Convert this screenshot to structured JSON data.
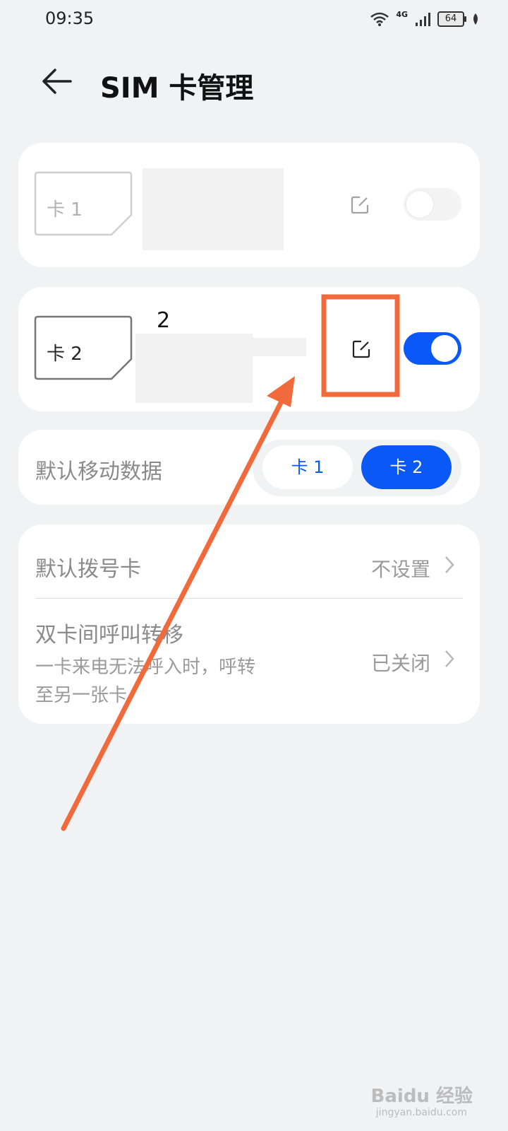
{
  "status_bar": {
    "time": "09:35",
    "network": "4G",
    "battery": "64"
  },
  "header": {
    "title": "SIM 卡管理"
  },
  "sim1": {
    "icon_label": "卡 1",
    "enabled": false
  },
  "sim2": {
    "icon_label": "卡 2",
    "name": "2",
    "enabled": true
  },
  "default_data": {
    "label": "默认移动数据",
    "options": [
      "卡 1",
      "卡 2"
    ],
    "selected": "卡 2"
  },
  "default_dial": {
    "label": "默认拨号卡",
    "value": "不设置"
  },
  "call_forward": {
    "title": "双卡间呼叫转移",
    "subtitle_line1": "一卡来电无法呼入时，呼转",
    "subtitle_line2": "至另一张卡",
    "value": "已关闭"
  },
  "watermark": {
    "text": "Baidu 经验",
    "sub": "jingyan.baidu.com"
  },
  "colors": {
    "accent": "#0a59f7",
    "annotation": "#f06a3b",
    "background": "#f1f2f4"
  }
}
